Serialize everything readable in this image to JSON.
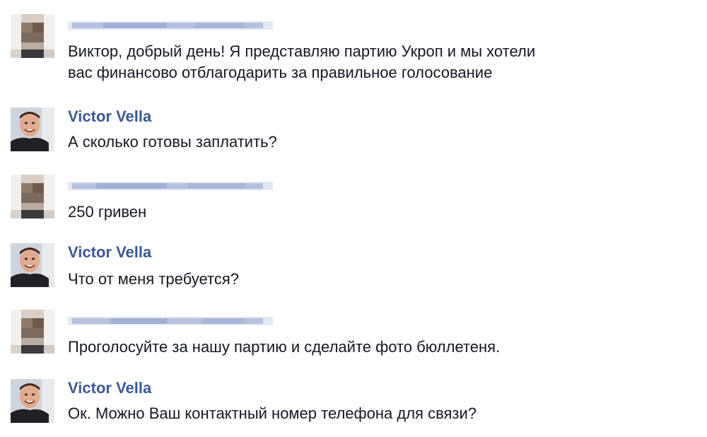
{
  "messages": [
    {
      "sender": "",
      "lines": [
        "Виктор, добрый день! Я представляю партию Укроп и мы хотели",
        "вас финансово отблагодарить за правильное голосование"
      ]
    },
    {
      "sender": "Victor Vella",
      "lines": [
        "А сколько готовы заплатить?"
      ]
    },
    {
      "sender": "",
      "lines": [
        "250 гривен"
      ]
    },
    {
      "sender": "Victor Vella",
      "lines": [
        "Что от меня требуется?"
      ]
    },
    {
      "sender": "",
      "lines": [
        "Проголосуйте за нашу партию и сделайте фото бюллетеня."
      ]
    },
    {
      "sender": "Victor Vella",
      "lines": [
        "Ок. Можно Ваш контактный номер телефона для связи?"
      ]
    }
  ],
  "colors": {
    "name": "#3b5998",
    "text": "#141823",
    "blurred_name": "#a9b6d6"
  },
  "icons": {
    "pixelated_avatar": "pixelated-avatar-icon",
    "profile_photo": "profile-photo-icon"
  }
}
